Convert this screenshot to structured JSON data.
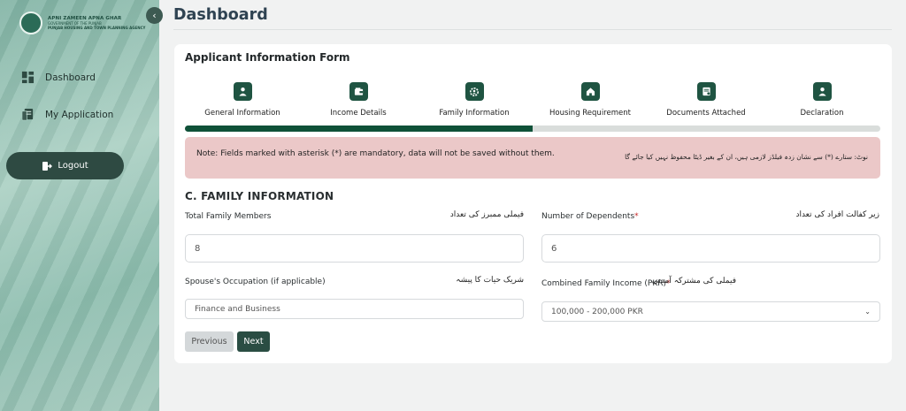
{
  "brand": {
    "line1": "APNI ZAMEEN APNA GHAR",
    "line2": "GOVERNMENT OF THE PUNJAB",
    "line3": "PUNJAB HOUSING AND TOWN PLANNING AGENCY"
  },
  "sidebar": {
    "items": [
      {
        "label": "Dashboard",
        "icon": "dashboard-icon"
      },
      {
        "label": "My Application",
        "icon": "application-icon"
      }
    ],
    "logout_label": "Logout"
  },
  "header": {
    "title": "Dashboard"
  },
  "form": {
    "title": "Applicant Information Form",
    "steps": [
      {
        "label": "General Information",
        "icon": "person-icon"
      },
      {
        "label": "Income Details",
        "icon": "wallet-icon"
      },
      {
        "label": "Family Information",
        "icon": "family-gear-icon"
      },
      {
        "label": "Housing Requirement",
        "icon": "house-icon"
      },
      {
        "label": "Documents Attached",
        "icon": "document-icon"
      },
      {
        "label": "Declaration",
        "icon": "person-icon"
      }
    ],
    "progress": 0.5,
    "note_en": "Note: Fields marked with asterisk (*) are mandatory, data will not be saved without them.",
    "note_ur": "نوٹ: ستارے (*) سے نشان زدہ فیلڈز لازمی ہیں، ان کے بغیر ڈیٹا محفوظ نہیں کیا جائے گا",
    "section_title": "C. FAMILY INFORMATION",
    "fields": {
      "total_members": {
        "label": "Total Family Members",
        "label_ur": "فیملی ممبرز کی تعداد",
        "value": "8"
      },
      "dependents": {
        "label": "Number of Dependents",
        "required_mark": "*",
        "label_ur": "زیر کفالت افراد کی تعداد",
        "value": "6"
      },
      "spouse_occupation": {
        "label": "Spouse's Occupation (if applicable)",
        "label_ur": "شریک حیات کا پیشہ",
        "value": "Finance and Business"
      },
      "combined_income": {
        "label": "Combined Family Income (PKR)",
        "required_mark": "*",
        "label_ur": "فیملی کی مشترکہ آمدنی",
        "value": "100,000 - 200,000 PKR"
      }
    },
    "prev_label": "Previous",
    "next_label": "Next"
  },
  "colors": {
    "accent": "#1f5442",
    "sidebar_bg": "#8bbcad",
    "note_bg": "#ebc8c8"
  }
}
